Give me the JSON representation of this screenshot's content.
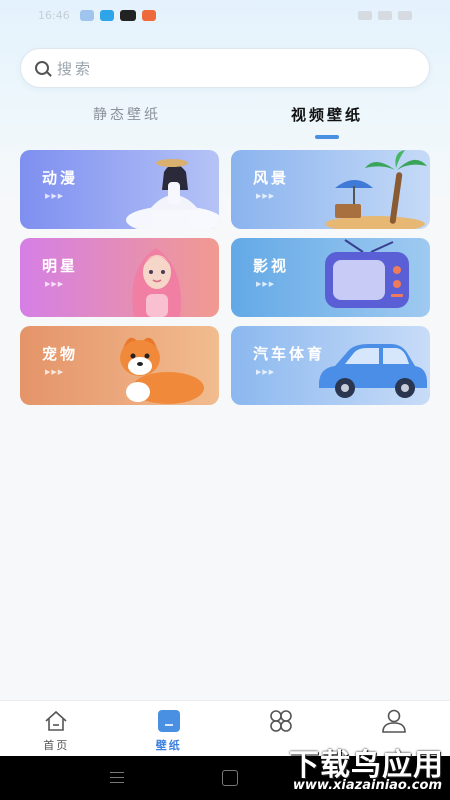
{
  "status_bar": {
    "time": "16:46"
  },
  "search": {
    "placeholder": "搜索"
  },
  "tabs": [
    {
      "label": "静态壁纸",
      "active": false
    },
    {
      "label": "视频壁纸",
      "active": true
    }
  ],
  "categories": [
    {
      "label": "动漫",
      "colors": [
        "#7e8ff0",
        "#b5c3f6"
      ],
      "art": "anime-girl"
    },
    {
      "label": "风景",
      "colors": [
        "#8ab3ee",
        "#c5daf7"
      ],
      "art": "beach-palm"
    },
    {
      "label": "明星",
      "colors": [
        "#d57fe6",
        "#f19a90"
      ],
      "art": "celebrity"
    },
    {
      "label": "影视",
      "colors": [
        "#63a9e6",
        "#9fcaf1"
      ],
      "art": "retro-tv"
    },
    {
      "label": "宠物",
      "colors": [
        "#e59469",
        "#f1bc8f"
      ],
      "art": "shiba-dog"
    },
    {
      "label": "汽车体育",
      "colors": [
        "#8bb8ef",
        "#c8dcf8"
      ],
      "art": "blue-car"
    }
  ],
  "play_hint": "▶▶▶",
  "bottom_nav": [
    {
      "label": "首页",
      "icon": "home-icon",
      "active": false
    },
    {
      "label": "壁纸",
      "icon": "wallpaper-icon",
      "active": true
    },
    {
      "label": "",
      "icon": "grid-icon",
      "active": false
    },
    {
      "label": "",
      "icon": "profile-icon",
      "active": false
    }
  ],
  "watermark": {
    "title": "下载鸟应用",
    "url": "www.xiazainiao.com"
  },
  "accent_color": "#4a90e2"
}
